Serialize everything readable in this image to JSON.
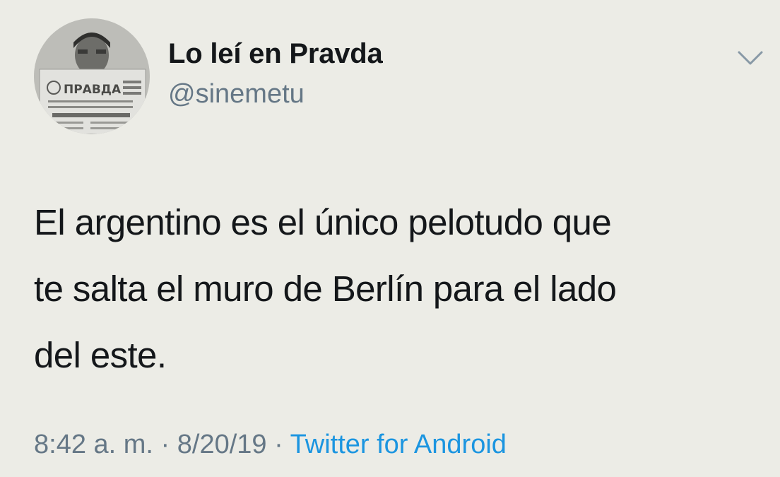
{
  "author": {
    "display_name": "Lo leí en Pravda",
    "handle": "@sinemetu",
    "avatar_newspaper_title": "ПРАВДА"
  },
  "tweet": {
    "lines": [
      "El argentino es el único pelotudo que",
      "te salta el muro de Berlín para el lado",
      "del este."
    ]
  },
  "meta": {
    "time": "8:42 a. m.",
    "separator": "·",
    "date": "8/20/19",
    "source": "Twitter for Android"
  },
  "icons": {
    "menu": "chevron-down-icon"
  },
  "colors": {
    "background": "#ecece6",
    "primary_text": "#14171a",
    "secondary_text": "#657786",
    "link": "#1b95e0"
  }
}
